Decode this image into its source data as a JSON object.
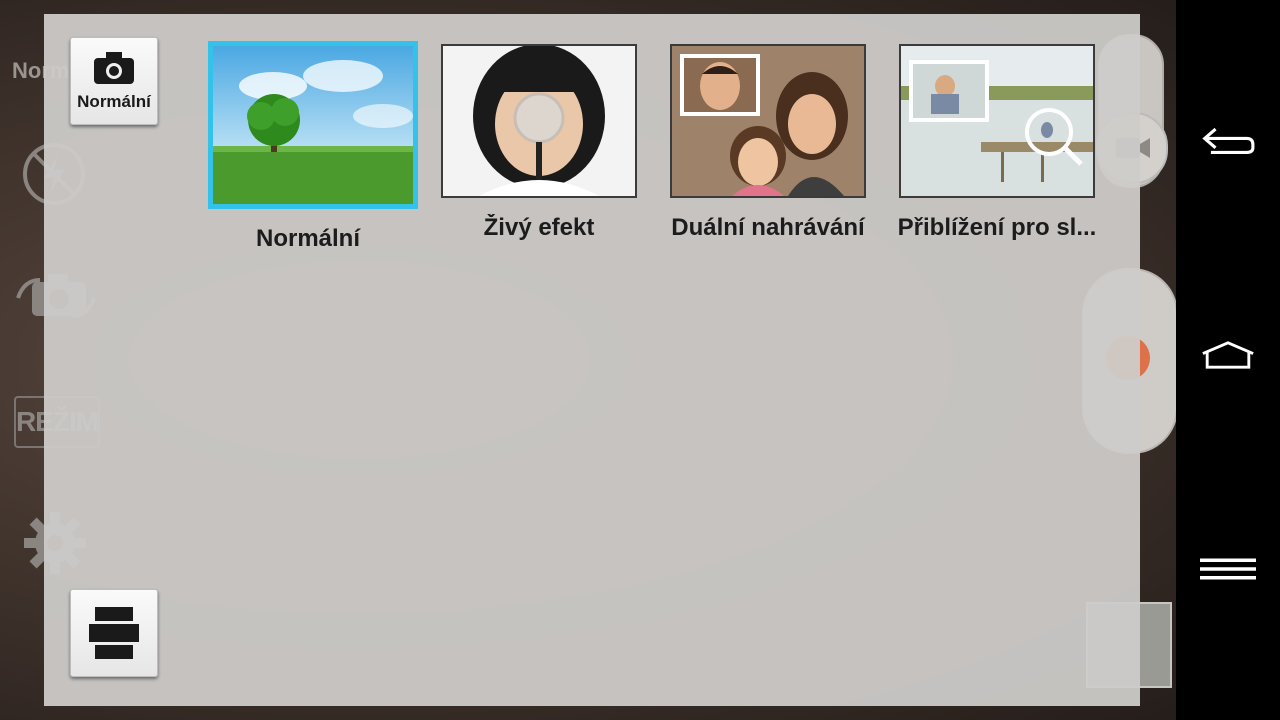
{
  "camera_background": {
    "mode_text": "Norm",
    "rezim_label": "REŽIM"
  },
  "panel": {
    "mode_button_label": "Normální",
    "modes": [
      {
        "label": "Normální",
        "selected": true,
        "thumb": "tree-on-meadow"
      },
      {
        "label": "Živý efekt",
        "selected": false,
        "thumb": "girl-with-magnifier"
      },
      {
        "label": "Duální nahrávání",
        "selected": false,
        "thumb": "family-with-pip"
      },
      {
        "label": "Přiblížení pro sl...",
        "selected": false,
        "thumb": "pier-zoom"
      }
    ]
  },
  "colors": {
    "selection": "#33c3ea",
    "panel_bg": "#cecccA",
    "shutter": "#e05a2a"
  },
  "icons": {
    "back": "back-arrow-icon",
    "home": "home-icon",
    "menu": "menu-icon",
    "camera": "camera-icon",
    "flash": "flash-off-icon",
    "swap": "switch-camera-icon",
    "gear": "gear-icon",
    "video": "video-icon"
  }
}
